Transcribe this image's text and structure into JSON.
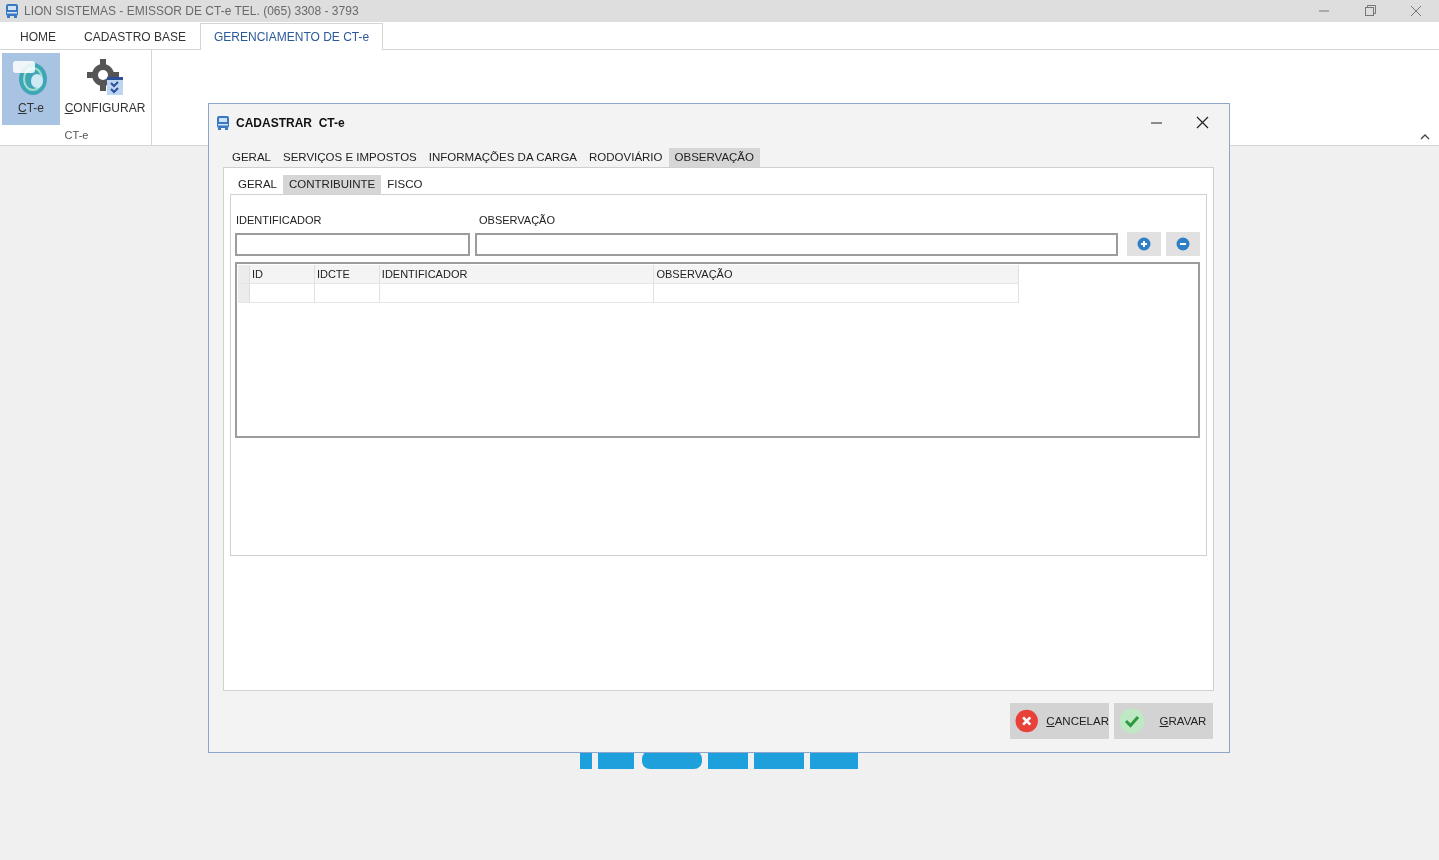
{
  "window": {
    "title": "LION SISTEMAS - EMISSOR DE CT-e  TEL. (065) 3308 - 3793"
  },
  "ribbon": {
    "tabs": [
      {
        "label": "HOME",
        "selected": false
      },
      {
        "label": "CADASTRO BASE",
        "selected": false
      },
      {
        "label": "GERENCIAMENTO DE CT-e",
        "selected": true
      }
    ],
    "buttons": [
      {
        "label": "CT-e",
        "kind": "cte",
        "selected": true,
        "underline_first": true
      },
      {
        "label": "CONFIGURAR",
        "kind": "gear",
        "selected": false,
        "underline_first": true
      }
    ],
    "group_label": "CT-e"
  },
  "dialog": {
    "title": "CADASTRAR  CT-e",
    "tabs": [
      {
        "label": "GERAL",
        "selected": false
      },
      {
        "label": "SERVIÇOS E IMPOSTOS",
        "selected": false
      },
      {
        "label": "INFORMAÇÕES DA CARGA",
        "selected": false
      },
      {
        "label": "RODOVIÁRIO",
        "selected": false
      },
      {
        "label": "OBSERVAÇÃO",
        "selected": true
      }
    ],
    "subtabs": [
      {
        "label": "GERAL",
        "selected": false
      },
      {
        "label": "CONTRIBUINTE",
        "selected": true
      },
      {
        "label": "FISCO",
        "selected": false
      }
    ],
    "fields": [
      {
        "label": "IDENTIFICADOR",
        "kind": "short"
      },
      {
        "label": "OBSERVAÇÃO",
        "kind": "long"
      }
    ],
    "grid": {
      "columns": [
        "ID",
        "IDCTE",
        "IDENTIFICADOR",
        "OBSERVAÇÃO"
      ]
    },
    "actions": [
      {
        "label": "CANCELAR",
        "kind": "cancel",
        "underline_first": true
      },
      {
        "label": "GRAVAR",
        "kind": "save",
        "underline_first": true
      }
    ]
  }
}
